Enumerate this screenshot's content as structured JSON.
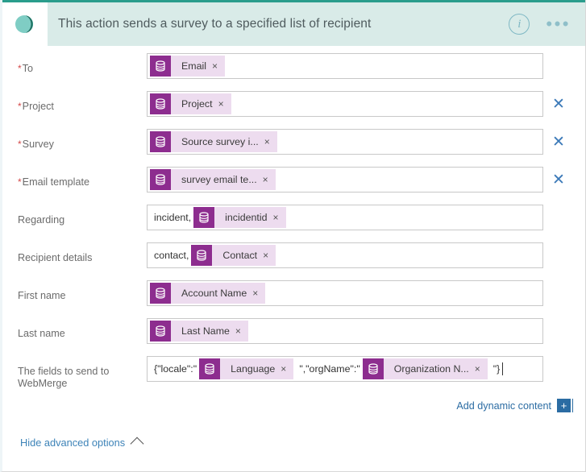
{
  "header": {
    "logo_icon": "dynamics-crm-logo-icon",
    "title": "This action sends a survey to a specified list of recipient",
    "info_icon": "info-icon",
    "more_icon": "ellipsis-more-icon",
    "info_label": "i",
    "more_label": "•••"
  },
  "form": {
    "rows": [
      {
        "label": "To",
        "required": true,
        "has_clear": false,
        "parts": [
          {
            "kind": "chip",
            "icon": "database-token-icon",
            "label": "Email",
            "remove": "×"
          }
        ]
      },
      {
        "label": "Project",
        "required": true,
        "has_clear": true,
        "parts": [
          {
            "kind": "chip",
            "icon": "database-token-icon",
            "label": "Project",
            "remove": "×"
          }
        ]
      },
      {
        "label": "Survey",
        "required": true,
        "has_clear": true,
        "parts": [
          {
            "kind": "chip",
            "icon": "database-token-icon",
            "label": "Source survey i...",
            "remove": "×"
          }
        ]
      },
      {
        "label": "Email template",
        "required": true,
        "has_clear": true,
        "parts": [
          {
            "kind": "chip",
            "icon": "database-token-icon",
            "label": "survey email te...",
            "remove": "×"
          }
        ]
      },
      {
        "label": "Regarding",
        "required": false,
        "has_clear": false,
        "parts": [
          {
            "kind": "text",
            "text": "incident,"
          },
          {
            "kind": "chip",
            "icon": "database-token-icon",
            "label": "incidentid",
            "remove": "×"
          }
        ]
      },
      {
        "label": "Recipient details",
        "required": false,
        "has_clear": false,
        "parts": [
          {
            "kind": "text",
            "text": "contact,"
          },
          {
            "kind": "chip",
            "icon": "database-token-icon",
            "label": "Contact",
            "remove": "×"
          }
        ]
      },
      {
        "label": "First name",
        "required": false,
        "has_clear": false,
        "parts": [
          {
            "kind": "chip",
            "icon": "database-token-icon",
            "label": "Account Name",
            "remove": "×"
          }
        ]
      },
      {
        "label": "Last name",
        "required": false,
        "has_clear": false,
        "parts": [
          {
            "kind": "chip",
            "icon": "database-token-icon",
            "label": "Last Name",
            "remove": "×"
          }
        ]
      },
      {
        "label": "The fields to send to WebMerge",
        "required": false,
        "has_clear": false,
        "parts": [
          {
            "kind": "text",
            "text": "{\"locale\":\""
          },
          {
            "kind": "chip",
            "icon": "database-token-icon",
            "label": "Language",
            "remove": "×"
          },
          {
            "kind": "text",
            "text": "\",\"orgName\":\""
          },
          {
            "kind": "chip",
            "icon": "database-token-icon",
            "label": "Organization N...",
            "remove": "×"
          },
          {
            "kind": "text",
            "text": "\"}"
          },
          {
            "kind": "caret"
          }
        ]
      }
    ]
  },
  "footer": {
    "add_dynamic_content": "Add dynamic content",
    "add_dynamic_plus": "+",
    "advanced_options": "Hide advanced options",
    "advanced_chevron_icon": "chevron-up-icon"
  },
  "colors": {
    "accent_teal": "#2a9d8c",
    "header_bg": "#d9ebe8",
    "token_purple": "#8d2d8f",
    "token_bg": "#eddcef",
    "link_blue": "#2b6ca3",
    "required_red": "#d44a4a"
  }
}
